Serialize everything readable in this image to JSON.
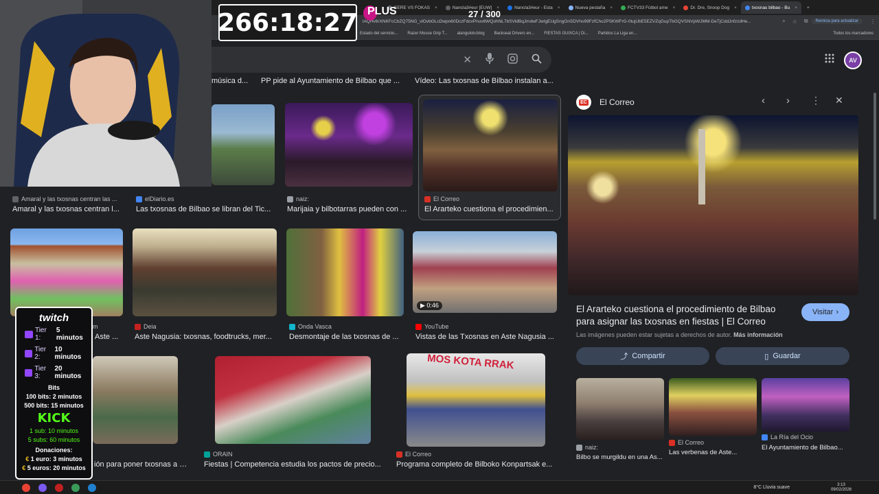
{
  "browser": {
    "tabs": [
      {
        "label": "SERE VS FOKAS",
        "color": "#5f6368",
        "active": false
      },
      {
        "label": "Nancla3#eur [EUW]",
        "color": "#5f6368",
        "active": false
      },
      {
        "label": "Nancla3#eur - Esta",
        "color": "#1a73e8",
        "active": false
      },
      {
        "label": "Nueva pestaña",
        "color": "#8ab4f8",
        "active": false
      },
      {
        "label": "FCTV33 Fútbol ame",
        "color": "#34a853",
        "active": false
      },
      {
        "label": "Dr. Dre, Snoop Dog",
        "color": "#ea4335",
        "active": false
      },
      {
        "label": "txosnas bilbao - Bu",
        "color": "#4285f4",
        "active": true
      }
    ],
    "url": "lAQHv6rXNKFcCbZQ75NG_vlOvbGLcDwpn60DczFdcvPnuv6WQohNL7bSVldBqJmdwFJwIgEUgSngOnSDVho99FzfCho2PSKWFrG-0tujUbE5EZVZqGupTbGQVSNVpWJMM-DeTjCddJnfzzdHe...",
    "update_label": "Reinicia para actualizar",
    "bookmarks": [
      "Estado del servicio...",
      "Razer Mouse Grip T...",
      "alangulotv.blog",
      "Backseat Drivers en...",
      "FIESTAS GUIXCA | Di...",
      "Partidos La Liga en..."
    ],
    "all_bookmarks": "Todos los marcadores"
  },
  "profile_initial": "AV",
  "row0_captions": [
    "música d...",
    "PP pide al Ayuntamiento de Bilbao que ...",
    "Vídeo: Las txosnas de Bilbao instalan a..."
  ],
  "row1": [
    {
      "source": "Amaral y las txosnas centran las ...",
      "caption": "Amaral y las txosnas centran l...",
      "color": "#5f6368"
    },
    {
      "source": "elDiario.es",
      "caption": "Las txosnas de Bilbao se libran del Tic...",
      "color": "#4285f4"
    },
    {
      "source": "naiz:",
      "caption": "Marijaia y bilbotarras pueden con ...",
      "color": "#9aa0a6"
    },
    {
      "source": "El Correo",
      "caption": "El Ararteko cuestiona el procedimien...",
      "color": "#d93025"
    }
  ],
  "row2": [
    {
      "source": "Deia",
      "caption": "Aste Nagusia: txosnas, foodtrucks, mer...",
      "color": "#c5221f"
    },
    {
      "source": "Onda Vasca",
      "caption": "Desmontaje de las txosnas de ...",
      "color": "#12b5cb"
    },
    {
      "source": "YouTube",
      "caption": "Vistas de las Txosnas en Aste Nagusia ...",
      "color": "#ff0000"
    },
    {
      "source": "m",
      "caption": "Aste ...",
      "color": "#5f6368"
    }
  ],
  "video_duration": "0:46",
  "row3": [
    {
      "source": "",
      "caption": "ión para poner txosnas a K...",
      "color": "#5f6368"
    },
    {
      "source": "ORAIN",
      "caption": "Fiestas | Competencia estudia los pactos de precio...",
      "color": "#00a19a"
    },
    {
      "source": "El Correo",
      "caption": "Programa completo de Bilboko Konpartsak e...",
      "color": "#d93025"
    }
  ],
  "stall_sign": "MOS KOTA RRAK",
  "panel": {
    "source": "El Correo",
    "source_badge": "EC",
    "title": "El Ararteko cuestiona el procedimiento de Bilbao para asignar las txosnas en fiestas | El Correo",
    "visit_label": "Visitar",
    "copyright_note": "Las imágenes pueden estar sujetas a derechos de autor.",
    "more_info": "Más información",
    "share_label": "Compartir",
    "save_label": "Guardar",
    "related": [
      {
        "source": "naiz:",
        "caption": "Bilbo se murgildu en una As...",
        "color": "#9aa0a6"
      },
      {
        "source": "El Correo",
        "caption": "Las verbenas de Aste...",
        "color": "#d93025"
      },
      {
        "source": "La Ría del Ocio",
        "caption": "El Ayuntamiento de Bilbao...",
        "color": "#4285f4"
      }
    ]
  },
  "overlay": {
    "timer": "266:18:27",
    "plus": "PLUS",
    "counter": "27 / 300",
    "twitch_logo": "twitch",
    "tiers": [
      {
        "label": "Tier 1:",
        "value": "5 minutos"
      },
      {
        "label": "Tier 2:",
        "value": "10 minutos"
      },
      {
        "label": "Tier 3:",
        "value": "20 minutos"
      }
    ],
    "bits_title": "Bits",
    "bits": [
      "100 bits: 2 minutos",
      "500 bits: 15 minutos"
    ],
    "kick_logo": "KICK",
    "kick": [
      "1 sub: 10 minutos",
      "5 subs: 60 minutos"
    ],
    "donations_title": "Donaciones:",
    "donations": [
      "1 euro: 3 minutos",
      "5 euros: 20 minutos"
    ]
  },
  "taskbar": {
    "weather": "8°C  Lluvia suave",
    "time": "3:13",
    "date": "09/02/2026"
  }
}
